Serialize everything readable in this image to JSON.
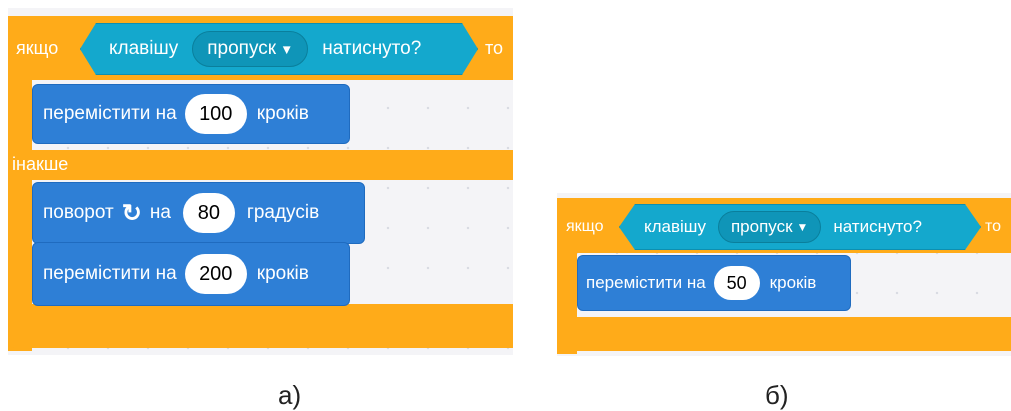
{
  "panel_a": {
    "if_label": "якщо",
    "key_label": "клавішу",
    "key_value": "пропуск",
    "pressed_label": "натиснуто?",
    "then_label": "то",
    "move1": {
      "prefix": "перемістити на",
      "value": "100",
      "suffix": "кроків"
    },
    "else_label": "інакше",
    "turn": {
      "prefix": "поворот",
      "mid": "на",
      "value": "80",
      "suffix": "градусів"
    },
    "move2": {
      "prefix": "перемістити на",
      "value": "200",
      "suffix": "кроків"
    },
    "caption": "а)"
  },
  "panel_b": {
    "if_label": "якщо",
    "key_label": "клавішу",
    "key_value": "пропуск",
    "pressed_label": "натиснуто?",
    "then_label": "то",
    "move": {
      "prefix": "перемістити на",
      "value": "50",
      "suffix": "кроків"
    },
    "caption": "б)"
  },
  "icons": {
    "dropdown": "caret-down-icon",
    "turn": "rotate-clockwise-icon"
  },
  "colors": {
    "control": "#ffab19",
    "motion": "#2e7fd6",
    "sensing": "#14a8cd",
    "workspace": "#f4f4f7"
  }
}
